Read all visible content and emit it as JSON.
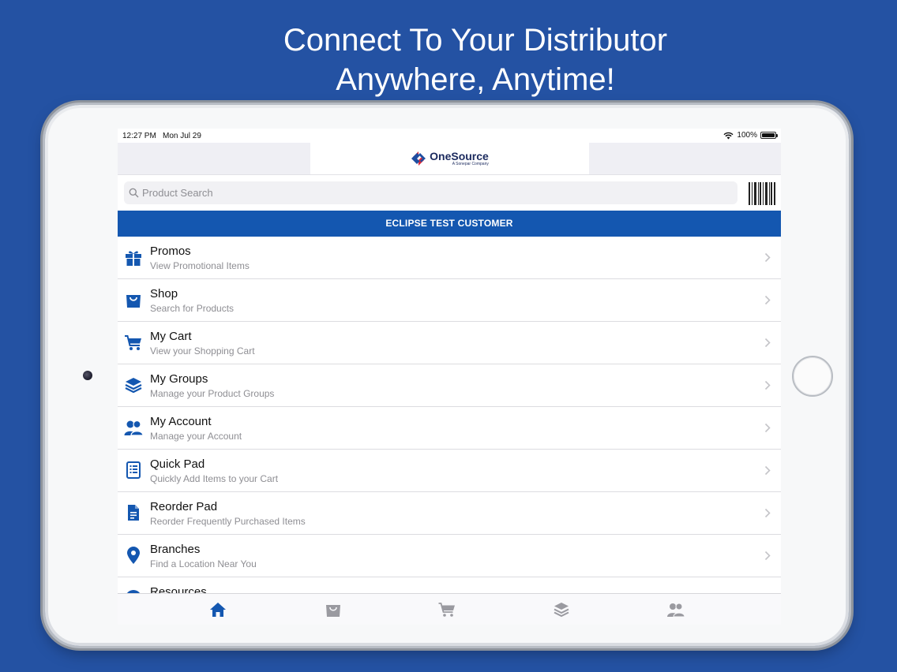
{
  "headline": {
    "line1": "Connect To Your Distributor",
    "line2": "Anywhere, Anytime!"
  },
  "status": {
    "time": "12:27 PM",
    "date": "Mon Jul 29",
    "battery": "100%"
  },
  "logo": {
    "name": "OneSource",
    "sub": "A Sonepar Company"
  },
  "search": {
    "placeholder": "Product Search"
  },
  "customer": {
    "name": "ECLIPSE TEST CUSTOMER"
  },
  "menu": {
    "items": [
      {
        "title": "Promos",
        "subtitle": "View Promotional Items",
        "icon": "gift-icon"
      },
      {
        "title": "Shop",
        "subtitle": "Search for Products",
        "icon": "shopping-bag-icon"
      },
      {
        "title": "My Cart",
        "subtitle": "View your Shopping Cart",
        "icon": "cart-icon"
      },
      {
        "title": "My Groups",
        "subtitle": "Manage your Product Groups",
        "icon": "layers-icon"
      },
      {
        "title": "My Account",
        "subtitle": "Manage your Account",
        "icon": "users-icon"
      },
      {
        "title": "Quick Pad",
        "subtitle": "Quickly Add Items to your Cart",
        "icon": "notepad-icon"
      },
      {
        "title": "Reorder Pad",
        "subtitle": "Reorder Frequently Purchased Items",
        "icon": "document-icon"
      },
      {
        "title": "Branches",
        "subtitle": "Find a Location Near You",
        "icon": "location-pin-icon"
      },
      {
        "title": "Resources",
        "subtitle": "",
        "icon": "info-icon"
      }
    ]
  },
  "tabbar": {
    "tabs": [
      "home-icon",
      "shopping-bag-icon",
      "cart-icon",
      "layers-icon",
      "users-icon"
    ],
    "active": "home-icon"
  },
  "colors": {
    "background": "#2452a3",
    "brand_blue": "#1457b0",
    "icon_blue": "#1457b0",
    "tab_inactive": "#9a9aa0"
  }
}
